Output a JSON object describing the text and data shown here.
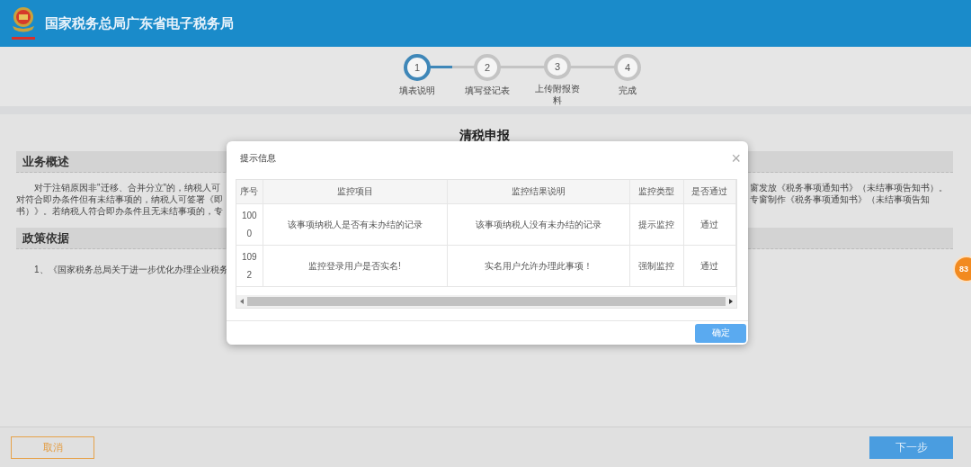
{
  "header": {
    "title": "国家税务总局广东省电子税务局"
  },
  "steps": [
    {
      "number": "1",
      "label": "填表说明",
      "selected": true
    },
    {
      "number": "2",
      "label": "填写登记表",
      "selected": false
    },
    {
      "number": "3",
      "label": "上传附报资料",
      "selected": false
    },
    {
      "number": "4",
      "label": "完成",
      "selected": false
    }
  ],
  "page_title": "清税申报",
  "sections": [
    {
      "heading": "业务概述",
      "lines_left": [
        "对于注销原因非\"迁移、合并分立\"的，纳税人可",
        "对符合即办条件但有未结事项的，纳税人可签署《即",
        "书）》。若纳税人符合即办条件且无未结事项的，专"
      ],
      "lines_right": [
        "窗发放《税务事项通知书》（未结事项告知书）。",
        "专窗制作《税务事项通知书》（未结事项告知"
      ]
    },
    {
      "heading": "政策依据",
      "lines_left": [
        "1、《国家税务总局关于进一步优化办理企业税务"
      ]
    }
  ],
  "floating_badge": "83",
  "dialog": {
    "title": "提示信息",
    "close": "×",
    "table": {
      "columns": [
        "序号",
        "监控项目",
        "监控结果说明",
        "监控类型",
        "是否通过"
      ],
      "rows": [
        [
          "1000",
          "该事项纳税人是否有未办结的记录",
          "该事项纳税人没有未办结的记录",
          "提示监控",
          "通过"
        ],
        [
          "1092",
          "监控登录用户是否实名!",
          "实名用户允许办理此事项！",
          "强制监控",
          "通过"
        ]
      ]
    },
    "ok_button": "确定"
  },
  "footer": {
    "cancel_button": "取消",
    "next_button": "下一步"
  }
}
